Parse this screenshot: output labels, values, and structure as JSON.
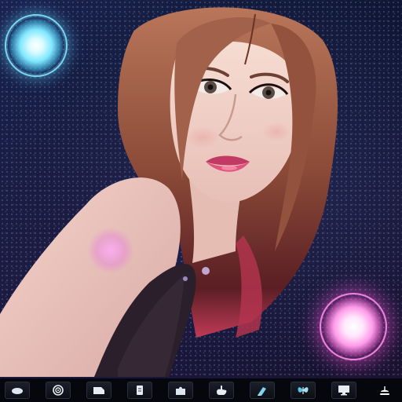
{
  "scene": {
    "subject": "portrait-image",
    "orbs": [
      {
        "name": "cyan-glow-orb",
        "color": "#7fe7ff"
      },
      {
        "name": "pink-glow-orb",
        "color": "#ff8ae6"
      },
      {
        "name": "shoulder-glow",
        "color": "#e88ae8"
      }
    ]
  },
  "toolbar": {
    "items": [
      {
        "icon": "ellipse-tool-icon"
      },
      {
        "icon": "spiral-icon"
      },
      {
        "icon": "shape-tool-icon"
      },
      {
        "icon": "document-icon"
      },
      {
        "icon": "puzzle-icon"
      },
      {
        "icon": "hand-icon"
      },
      {
        "icon": "brush-icon"
      },
      {
        "icon": "butterfly-icon"
      },
      {
        "icon": "monitor-icon"
      },
      {
        "icon": "lamp-icon"
      }
    ]
  },
  "colors": {
    "background": "#121a3a",
    "toolbar": "#05070d",
    "accent_cyan": "#7fe7ff",
    "accent_pink": "#ff8ae6"
  }
}
